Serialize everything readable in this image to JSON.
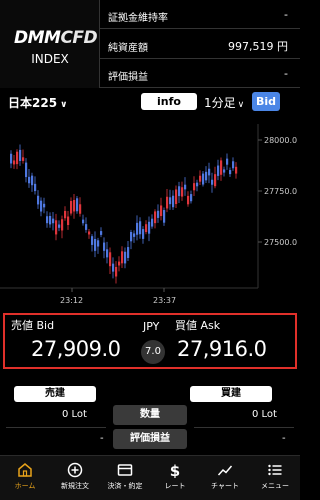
{
  "brand": {
    "logo_main": "DMM",
    "logo_cfd": "CFD",
    "logo_sub": "INDEX"
  },
  "metrics": [
    {
      "label": "証拠金維持率",
      "value": "-"
    },
    {
      "label": "純資産額",
      "value": "997,519 円"
    },
    {
      "label": "評価損益",
      "value": "-"
    }
  ],
  "toolbar": {
    "symbol": "日本225",
    "info": "info",
    "interval": "1分足",
    "price_side": "Bid"
  },
  "colors": {
    "up": "#e0353b",
    "down": "#4f78e0",
    "accent": "#e8a31b",
    "bid_button": "#4b86e6",
    "highlight_border": "#e0302a"
  },
  "chart_data": {
    "type": "candlestick",
    "y_ticks": [
      "28000.0",
      "27750.0",
      "27500.0"
    ],
    "x_ticks": [
      "23:12",
      "23:37"
    ]
  },
  "quote": {
    "bid_label": "売値 Bid",
    "bid": "27,909.0",
    "currency": "JPY",
    "spread": "7.0",
    "ask_label": "買値 Ask",
    "ask": "27,916.0"
  },
  "positions": {
    "sell_close": "売建",
    "buy_close": "買建",
    "sell_lot": "0 Lot",
    "buy_lot": "0 Lot",
    "sell_pl": "-",
    "buy_pl": "-",
    "qty_label": "数量",
    "pl_label": "評価損益"
  },
  "nav": [
    {
      "label": "ホーム",
      "icon": "home-icon"
    },
    {
      "label": "新規注文",
      "icon": "plus-circle-icon"
    },
    {
      "label": "決済・約定",
      "icon": "card-icon"
    },
    {
      "label": "レート",
      "icon": "dollar-icon"
    },
    {
      "label": "チャート",
      "icon": "line-chart-icon"
    },
    {
      "label": "メニュー",
      "icon": "menu-icon"
    }
  ]
}
